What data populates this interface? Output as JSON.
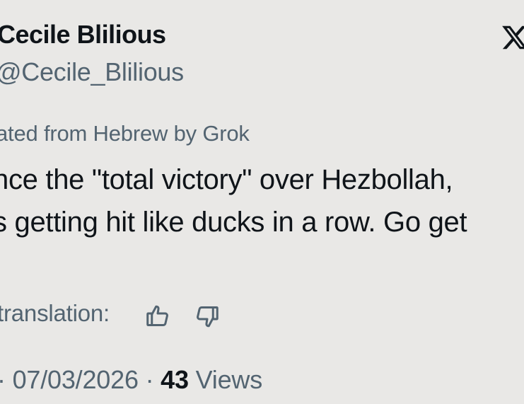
{
  "tweet": {
    "display_name": "Cecile Blilious",
    "handle": "@Cecile_Blilious",
    "translated_note": "ated from Hebrew by Grok",
    "text_line_1": "nce the \"total victory\" over Hezbollah,",
    "text_line_2": "s getting hit like ducks in a row. Go get",
    "rate_translation_label": "translation:",
    "date_prefix": "· 07/03/2026 · ",
    "views_count": "43",
    "views_label": " Views",
    "platform_logo": "x-logo"
  },
  "icons": {
    "like_translation": "thumbs-up-icon",
    "dislike_translation": "thumbs-down-icon"
  },
  "colors": {
    "background": "#e9e8e6",
    "primary_text": "#0f1419",
    "secondary_text": "#536471"
  }
}
